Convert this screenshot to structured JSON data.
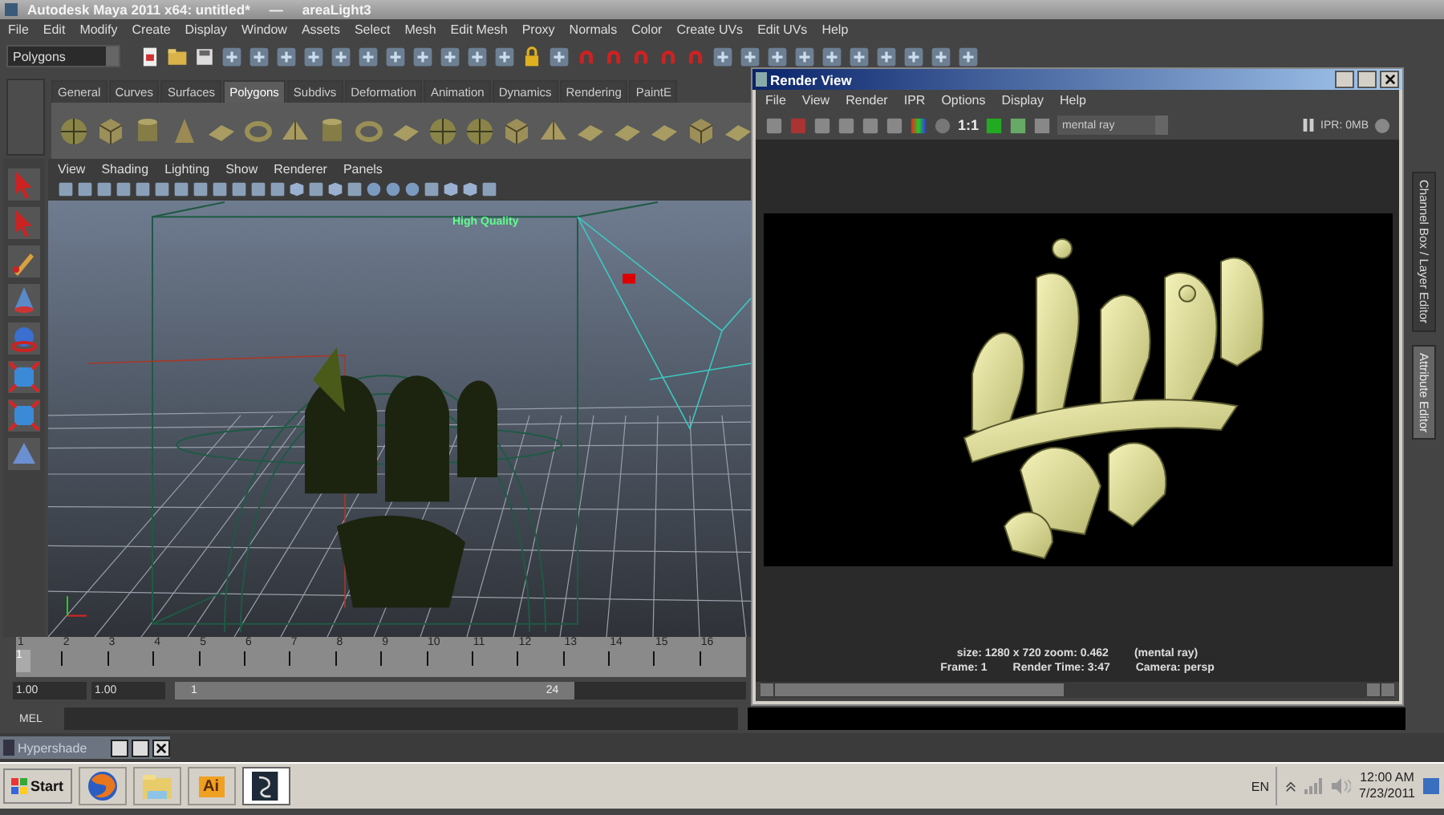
{
  "window": {
    "title": "Autodesk Maya 2011 x64: untitled*",
    "separator": "—",
    "object": "areaLight3"
  },
  "menu": [
    "File",
    "Edit",
    "Modify",
    "Create",
    "Display",
    "Window",
    "Assets",
    "Select",
    "Mesh",
    "Edit Mesh",
    "Proxy",
    "Normals",
    "Color",
    "Create UVs",
    "Edit UVs",
    "Help"
  ],
  "status_line": {
    "mode": "Polygons"
  },
  "shelf": {
    "tabs": [
      {
        "label": "General",
        "selected": false
      },
      {
        "label": "Curves",
        "selected": false
      },
      {
        "label": "Surfaces",
        "selected": false
      },
      {
        "label": "Polygons",
        "selected": true
      },
      {
        "label": "Subdivs",
        "selected": false
      },
      {
        "label": "Deformation",
        "selected": false
      },
      {
        "label": "Animation",
        "selected": false
      },
      {
        "label": "Dynamics",
        "selected": false
      },
      {
        "label": "Rendering",
        "selected": false
      },
      {
        "label": "PaintE",
        "selected": false
      }
    ]
  },
  "viewport": {
    "menu": [
      "View",
      "Shading",
      "Lighting",
      "Show",
      "Renderer",
      "Panels"
    ],
    "hud_label": "High Quality"
  },
  "side_tabs": [
    {
      "label": "Channel Box / Layer Editor",
      "selected": false
    },
    {
      "label": "Attribute Editor",
      "selected": true
    }
  ],
  "render_view": {
    "title": "Render View",
    "menu": [
      "File",
      "View",
      "Render",
      "IPR",
      "Options",
      "Display",
      "Help"
    ],
    "ratio": "1:1",
    "renderer": "mental ray",
    "ipr": "IPR: 0MB",
    "size_info": "size: 1280 x 720 zoom: 0.462",
    "renderer_note": "(mental ray)",
    "frame": "Frame: 1",
    "render_time": "Render Time: 3:47",
    "camera": "Camera: persp"
  },
  "time_slider": {
    "level": 0,
    "ticks": [
      "1",
      "2",
      "3",
      "4",
      "5",
      "6",
      "7",
      "8",
      "9",
      "10",
      "11",
      "12",
      "13",
      "14",
      "15",
      "16"
    ],
    "current_frame": "1"
  },
  "range_slider": {
    "level": 0.7,
    "start": "1.00",
    "playback_start": "1.00",
    "range_start": "1",
    "range_end": "24"
  },
  "command_line": {
    "label": "MEL"
  },
  "minimized_window": {
    "title": "Hypershade"
  },
  "taskbar": {
    "start": "Start",
    "apps": [
      {
        "kind": "browser",
        "selected": false
      },
      {
        "kind": "folder",
        "selected": false
      },
      {
        "kind": "illustrator",
        "label": "Ai",
        "selected": false
      },
      {
        "kind": "maya",
        "selected": true
      }
    ],
    "language": "EN",
    "time": "12:00 AM",
    "date": "7/23/2011"
  }
}
